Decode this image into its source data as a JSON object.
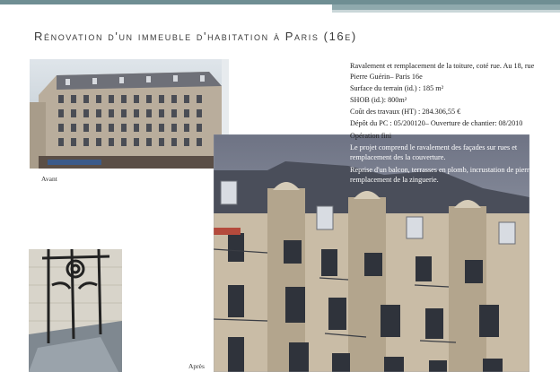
{
  "title": "Rénovation d'un immeuble d'habitation à Paris (16e)",
  "info": {
    "p1": "Ravalement et remplacement de la toiture, coté rue. Au 18, rue Pierre Guérin– Paris 16e",
    "p2": "Surface du terrain (id.) : 185 m²",
    "p3": "SHOB (id.): 800m²",
    "p4": "Coût des travaux (HT) : 284.306,55 €",
    "p5": "Dépôt du PC : 05/200120– Ouverture de chantier: 08/2010",
    "p6": "Opération fini",
    "p7": "Le projet comprend le ravalement des façades sur rues et remplacement des la couverture.",
    "p8": "Reprise d'un balcon, terrasses en plomb, incrustation de pierre et remplacement de la zinguerie."
  },
  "captions": {
    "before": "Avant",
    "after": "Après"
  },
  "colors": {
    "topbar": "#6f8e93",
    "stone": "#c9bca6",
    "sky": "#8e97a8"
  }
}
